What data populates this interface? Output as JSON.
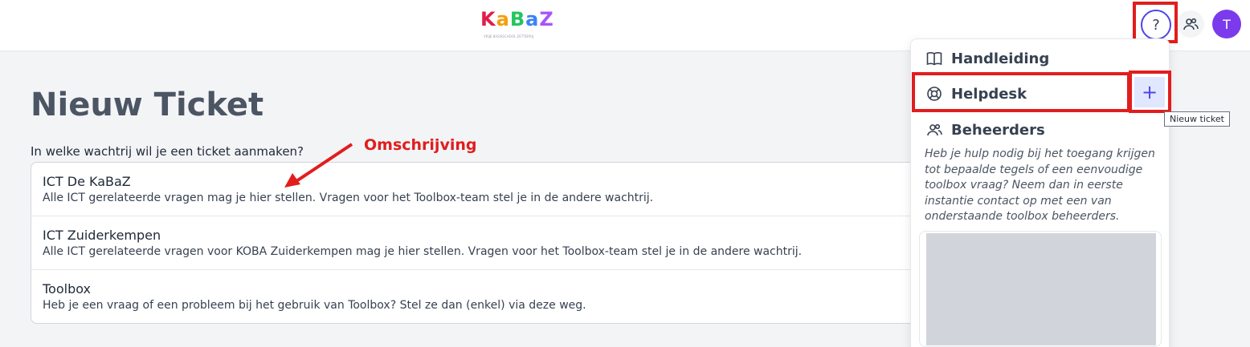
{
  "header": {
    "logo_text": "KaBaZ",
    "logo_tagline": "VRIJE BASISSCHOOL ZETTERRIJ",
    "help_label": "?",
    "avatar_initial": "T"
  },
  "page": {
    "title": "Nieuw Ticket",
    "question": "In welke wachtrij wil je een ticket aanmaken?"
  },
  "queues": [
    {
      "name": "ICT De KaBaZ",
      "description": "Alle ICT gerelateerde vragen mag je hier stellen. Vragen voor het Toolbox-team stel je in de andere wachtrij."
    },
    {
      "name": "ICT Zuiderkempen",
      "description": "Alle ICT gerelateerde vragen voor KOBA Zuiderkempen mag je hier stellen. Vragen voor het Toolbox-team stel je in de andere wachtrij."
    },
    {
      "name": "Toolbox",
      "description": "Heb je een vraag of een probleem bij het gebruik van Toolbox? Stel ze dan (enkel) via deze weg."
    }
  ],
  "annotation": {
    "label": "Omschrijving"
  },
  "dropdown": {
    "handleiding": "Handleiding",
    "helpdesk": "Helpdesk",
    "beheerders": "Beheerders",
    "plus": "+",
    "tooltip": "Nieuw ticket",
    "info": "Heb je hulp nodig bij het toegang krijgen tot bepaalde tegels of een eenvoudige toolbox vraag? Neem dan in eerste instantie contact op met een van onderstaande toolbox beheerders."
  },
  "colors": {
    "accent": "#4f46e5",
    "avatar": "#7c3aed",
    "highlight": "#e11d1d"
  }
}
